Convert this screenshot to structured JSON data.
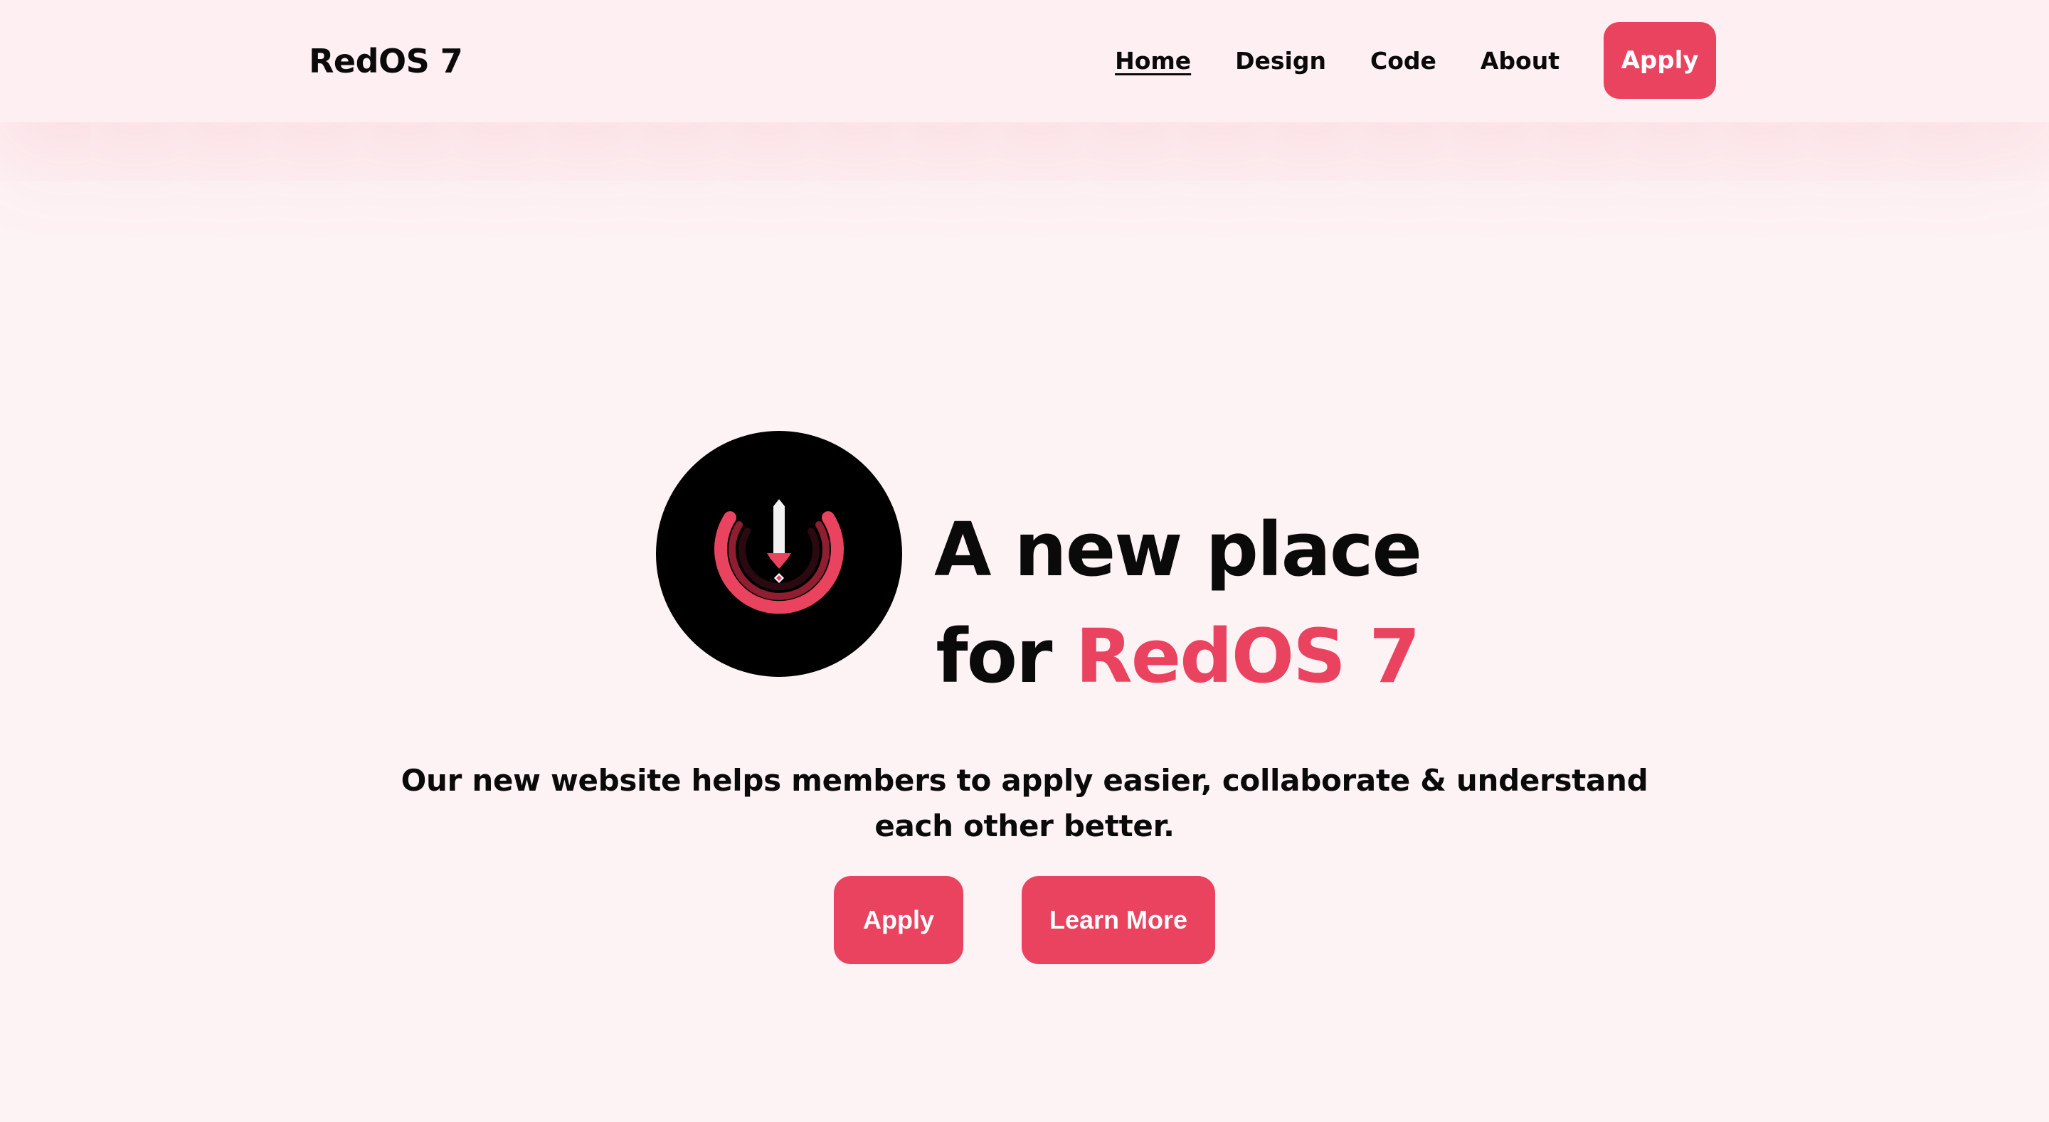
{
  "brand": "RedOS 7",
  "nav": {
    "links": [
      "Home",
      "Design",
      "Code",
      "About"
    ],
    "active": "Home",
    "apply_label": "Apply"
  },
  "hero": {
    "logo_icon": "power-sword-icon",
    "title_line1": "A new place",
    "title_line2_prefix": "for",
    "title_line2_accent": "RedOS 7",
    "description_line1": "Our new website helps members to apply easier, collaborate & understand",
    "description_line2": "each other better.",
    "apply_label": "Apply",
    "learn_more_label": "Learn More"
  },
  "colors": {
    "accent": "#e9435f",
    "background": "#fdf2f4",
    "text": "#0a0a0a"
  }
}
